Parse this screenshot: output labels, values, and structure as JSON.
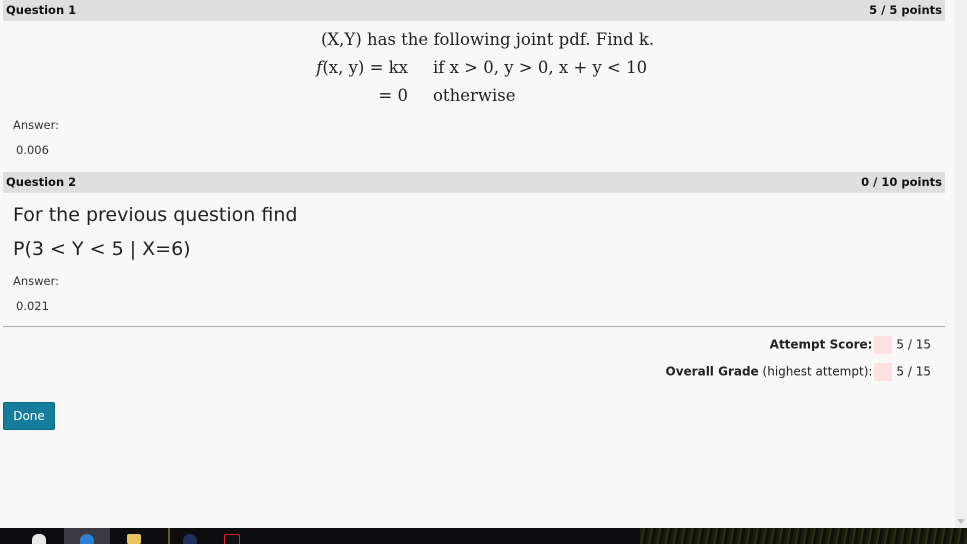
{
  "question1": {
    "title": "Question 1",
    "score": "5 / 5 points",
    "line1": "(X,Y) has the following joint pdf. Find k.",
    "row1_lhs_func": "f",
    "row1_lhs_args": "(x, y) = kx",
    "row1_rhs": "if x > 0, y > 0, x + y < 10",
    "row2_lhs": "= 0",
    "row2_rhs": "otherwise",
    "answer_label": "Answer:",
    "answer_value": "0.006"
  },
  "question2": {
    "title": "Question 2",
    "score": "0 / 10 points",
    "text_line1": "For the previous question find",
    "text_line2": "P(3 < Y < 5 | X=6)",
    "answer_label": "Answer:",
    "answer_value": "0.021"
  },
  "summary": {
    "attempt_label": "Attempt Score:",
    "attempt_value": "5 / 15",
    "overall_label": "Overall Grade",
    "overall_suffix": "(highest attempt):",
    "overall_value": "5 / 15"
  },
  "done_label": "Done",
  "taskbar_icons": [
    "start-icon",
    "browser-icon",
    "folder-icon",
    "app-icon",
    "pdf-icon"
  ]
}
